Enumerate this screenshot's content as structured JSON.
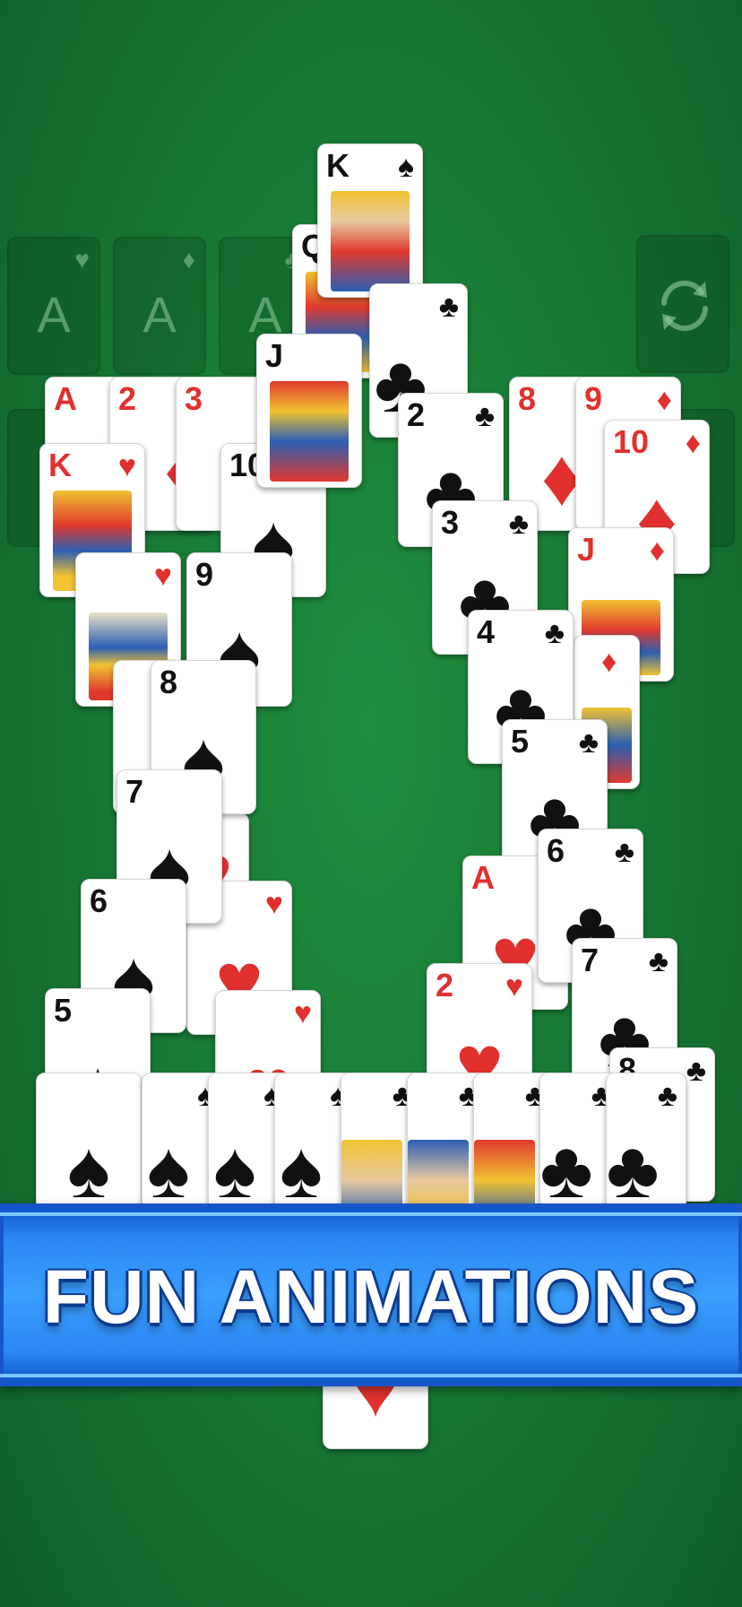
{
  "banner": {
    "title": "FUN ANIMATIONS"
  },
  "foundations": [
    {
      "rank": "A",
      "suit": "♥"
    },
    {
      "rank": "A",
      "suit": "♦"
    },
    {
      "rank": "A",
      "suit": "♣"
    }
  ],
  "recycle": {
    "icon": "recycle-icon"
  },
  "colors": {
    "felt": "#187a35",
    "banner": "#2a86f0",
    "red": "#e0312e",
    "black": "#111111"
  },
  "cards": [
    {
      "rank": "A",
      "suit": "♥",
      "color": "red"
    },
    {
      "rank": "2",
      "suit": "♦",
      "color": "red"
    },
    {
      "rank": "3",
      "suit": "♦",
      "color": "red"
    },
    {
      "rank": "8",
      "suit": "♦",
      "color": "red"
    },
    {
      "rank": "9",
      "suit": "♦",
      "color": "red"
    },
    {
      "rank": "10",
      "suit": "♦",
      "color": "red"
    },
    {
      "rank": "J",
      "suit": "♦",
      "color": "red"
    },
    {
      "rank": "K",
      "suit": "♥",
      "color": "red"
    },
    {
      "rank": "10",
      "suit": "♠",
      "color": "black"
    },
    {
      "rank": "9",
      "suit": "♠",
      "color": "black"
    },
    {
      "rank": "8",
      "suit": "♠",
      "color": "black"
    },
    {
      "rank": "7",
      "suit": "♠",
      "color": "black"
    },
    {
      "rank": "6",
      "suit": "♠",
      "color": "black"
    },
    {
      "rank": "5",
      "suit": "♠",
      "color": "black"
    },
    {
      "rank": "K",
      "suit": "♠",
      "color": "black"
    },
    {
      "rank": "Q",
      "suit": "♠",
      "color": "black"
    },
    {
      "rank": "J",
      "suit": "♠",
      "color": "black"
    },
    {
      "rank": "2",
      "suit": "♣",
      "color": "black"
    },
    {
      "rank": "3",
      "suit": "♣",
      "color": "black"
    },
    {
      "rank": "4",
      "suit": "♣",
      "color": "black"
    },
    {
      "rank": "5",
      "suit": "♣",
      "color": "black"
    },
    {
      "rank": "6",
      "suit": "♣",
      "color": "black"
    },
    {
      "rank": "7",
      "suit": "♣",
      "color": "black"
    },
    {
      "rank": "8",
      "suit": "♣",
      "color": "black"
    },
    {
      "rank": "A",
      "suit": "♥",
      "color": "red"
    },
    {
      "rank": "2",
      "suit": "♥",
      "color": "red"
    }
  ]
}
